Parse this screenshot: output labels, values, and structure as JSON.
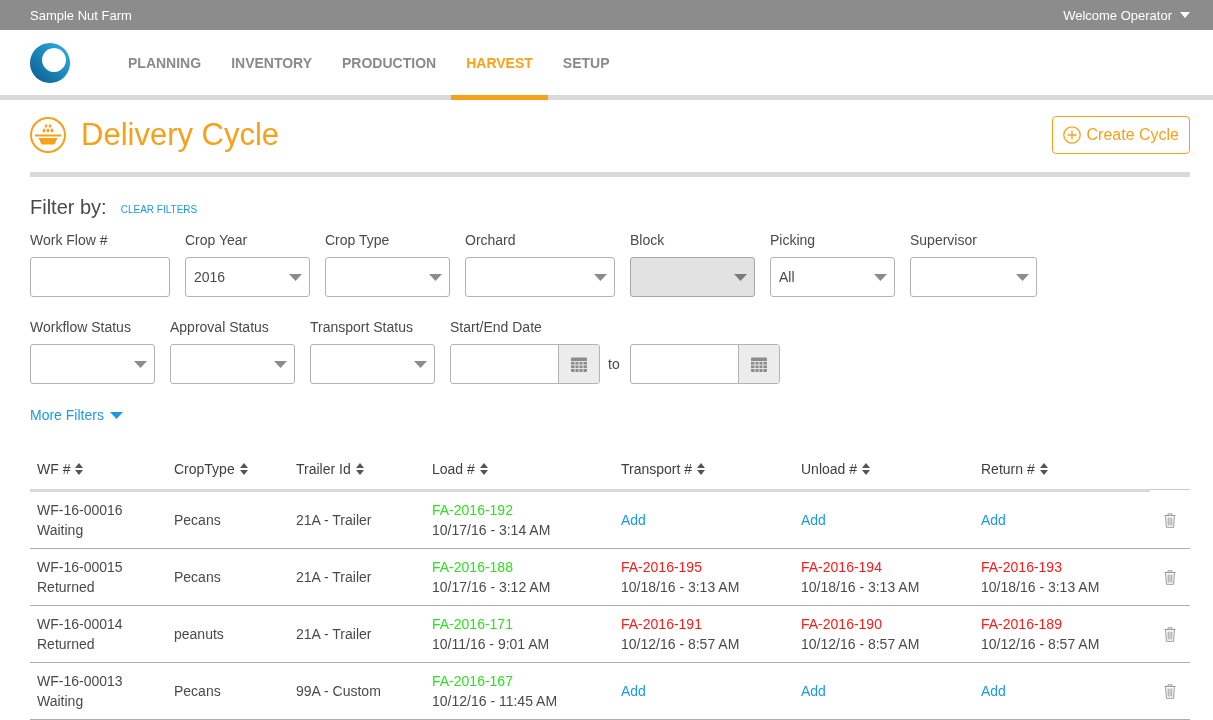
{
  "top_bar": {
    "farm_name": "Sample Nut Farm",
    "user_menu": "Welcome Operator"
  },
  "nav": {
    "tabs": [
      {
        "label": "PLANNING",
        "selected": false
      },
      {
        "label": "INVENTORY",
        "selected": false
      },
      {
        "label": "PRODUCTION",
        "selected": false
      },
      {
        "label": "HARVEST",
        "selected": true
      },
      {
        "label": "SETUP",
        "selected": false
      }
    ]
  },
  "page_header": {
    "title": "Delivery Cycle",
    "create_button": "Create Cycle"
  },
  "filters": {
    "heading": "Filter by:",
    "clear_link": "CLEAR FILTERS",
    "rows": [
      [
        {
          "label": "Work Flow #",
          "kind": "text",
          "disabled": false
        },
        {
          "label": "Crop Year",
          "kind": "select",
          "value": "2016",
          "disabled": false
        },
        {
          "label": "Crop Type",
          "kind": "select",
          "disabled": false
        },
        {
          "label": "Orchard",
          "kind": "select",
          "disabled": false
        },
        {
          "label": "Block",
          "kind": "select",
          "disabled": true
        },
        {
          "label": "Picking",
          "kind": "select",
          "value": "All",
          "disabled": false
        },
        {
          "label": "Supervisor",
          "kind": "select",
          "disabled": false
        }
      ],
      [
        {
          "label": "Workflow Status",
          "kind": "select",
          "disabled": false
        },
        {
          "label": "Approval Status",
          "kind": "select",
          "disabled": false
        },
        {
          "label": "Transport Status",
          "kind": "select",
          "disabled": false
        },
        {
          "label": "Start/End Date",
          "kind": "date_range",
          "separator": "to",
          "disabled": false
        }
      ]
    ],
    "more_link": "More Filters"
  },
  "table": {
    "columns": [
      {
        "label": "WF #"
      },
      {
        "label": "CropType"
      },
      {
        "label": "Trailer Id"
      },
      {
        "label": "Load #"
      },
      {
        "label": "Transport #"
      },
      {
        "label": "Unload #"
      },
      {
        "label": "Return #"
      }
    ],
    "rows": [
      {
        "workflow": "WF-16-00016",
        "status": "Waiting",
        "crop_type": "Pecans",
        "trailer_id": "21A - Trailer",
        "steps": [
          {
            "kind": "record",
            "number": "FA-2016-192",
            "time": "10/17/16 - 3:14 AM",
            "color": "#2fe01f"
          },
          {
            "kind": "add",
            "label": "Add"
          },
          {
            "kind": "add",
            "label": "Add"
          },
          {
            "kind": "add",
            "label": "Add"
          }
        ]
      },
      {
        "workflow": "WF-16-00015",
        "status": "Returned",
        "crop_type": "Pecans",
        "trailer_id": "21A - Trailer",
        "steps": [
          {
            "kind": "record",
            "number": "FA-2016-188",
            "time": "10/17/16 - 3:12 AM",
            "color": "#2fe01f"
          },
          {
            "kind": "record",
            "number": "FA-2016-195",
            "time": "10/18/16 - 3:13 AM",
            "color": "#ff1a1a"
          },
          {
            "kind": "record",
            "number": "FA-2016-194",
            "time": "10/18/16 - 3:13 AM",
            "color": "#ff1a1a"
          },
          {
            "kind": "record",
            "number": "FA-2016-193",
            "time": "10/18/16 - 3:13 AM",
            "color": "#ff1a1a"
          }
        ]
      },
      {
        "workflow": "WF-16-00014",
        "status": "Returned",
        "crop_type": "peanuts",
        "trailer_id": "21A - Trailer",
        "steps": [
          {
            "kind": "record",
            "number": "FA-2016-171",
            "time": "10/11/16 - 9:01 AM",
            "color": "#2fe01f"
          },
          {
            "kind": "record",
            "number": "FA-2016-191",
            "time": "10/12/16 - 8:57 AM",
            "color": "#ff1a1a"
          },
          {
            "kind": "record",
            "number": "FA-2016-190",
            "time": "10/12/16 - 8:57 AM",
            "color": "#ff1a1a"
          },
          {
            "kind": "record",
            "number": "FA-2016-189",
            "time": "10/12/16 - 8:57 AM",
            "color": "#ff1a1a"
          }
        ]
      },
      {
        "workflow": "WF-16-00013",
        "status": "Waiting",
        "crop_type": "Pecans",
        "trailer_id": "99A - Custom",
        "steps": [
          {
            "kind": "record",
            "number": "FA-2016-167",
            "time": "10/12/16 - 11:45 AM",
            "color": "#2fe01f"
          },
          {
            "kind": "add",
            "label": "Add"
          },
          {
            "kind": "add",
            "label": "Add"
          },
          {
            "kind": "add",
            "label": "Add"
          }
        ]
      }
    ]
  }
}
